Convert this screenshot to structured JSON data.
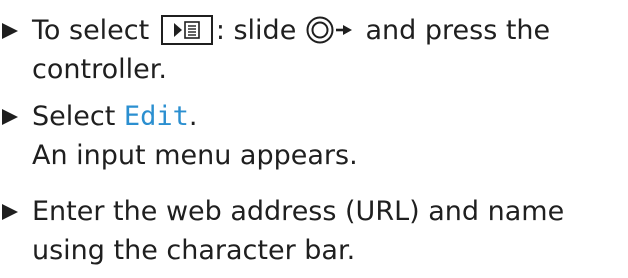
{
  "steps": [
    {
      "part1": "To select ",
      "menu_icon": "menu-list-icon",
      "part2": ": slide ",
      "controller_icon": "controller-slide-right-icon",
      "part3": " and press the controller."
    },
    {
      "before": "Select ",
      "highlight": "Edit",
      "after": ".",
      "result": "An input menu appears."
    },
    {
      "text": "Enter the web address (URL) and name using the character bar."
    }
  ],
  "colors": {
    "text": "#1f1f1f",
    "highlight": "#2b8fd0"
  }
}
